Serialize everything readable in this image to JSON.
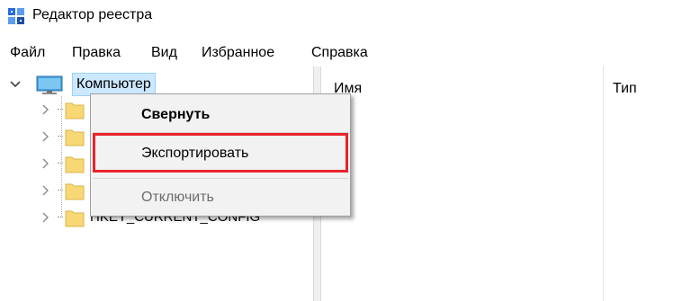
{
  "window": {
    "title": "Редактор реестра",
    "icon": "registry-editor-icon"
  },
  "menubar": {
    "items": [
      "Файл",
      "Правка",
      "Вид",
      "Избранное",
      "Справка"
    ]
  },
  "tree": {
    "root": {
      "label": "Компьютер",
      "icon": "computer-icon",
      "expanded": true,
      "selected": true
    },
    "children": [
      {
        "label": "",
        "icon": "folder-icon",
        "collapsed": true
      },
      {
        "label": "",
        "icon": "folder-icon",
        "collapsed": true
      },
      {
        "label": "",
        "icon": "folder-icon",
        "collapsed": true
      },
      {
        "label": "",
        "icon": "folder-icon",
        "collapsed": true
      },
      {
        "label": "HKEY_CURRENT_CONFIG",
        "icon": "folder-icon",
        "collapsed": true
      }
    ]
  },
  "list": {
    "columns": [
      "Имя",
      "Тип"
    ]
  },
  "context_menu": {
    "items": [
      {
        "label": "Свернуть",
        "style": "bold",
        "enabled": true
      },
      {
        "label": "Экспортировать",
        "style": "normal",
        "enabled": true,
        "highlighted": true
      },
      {
        "label": "Отключить",
        "style": "normal",
        "enabled": false
      }
    ]
  },
  "colors": {
    "selection": "#cce8ff",
    "highlight_border": "#e8242b",
    "menu_background": "#f2f2f2"
  }
}
